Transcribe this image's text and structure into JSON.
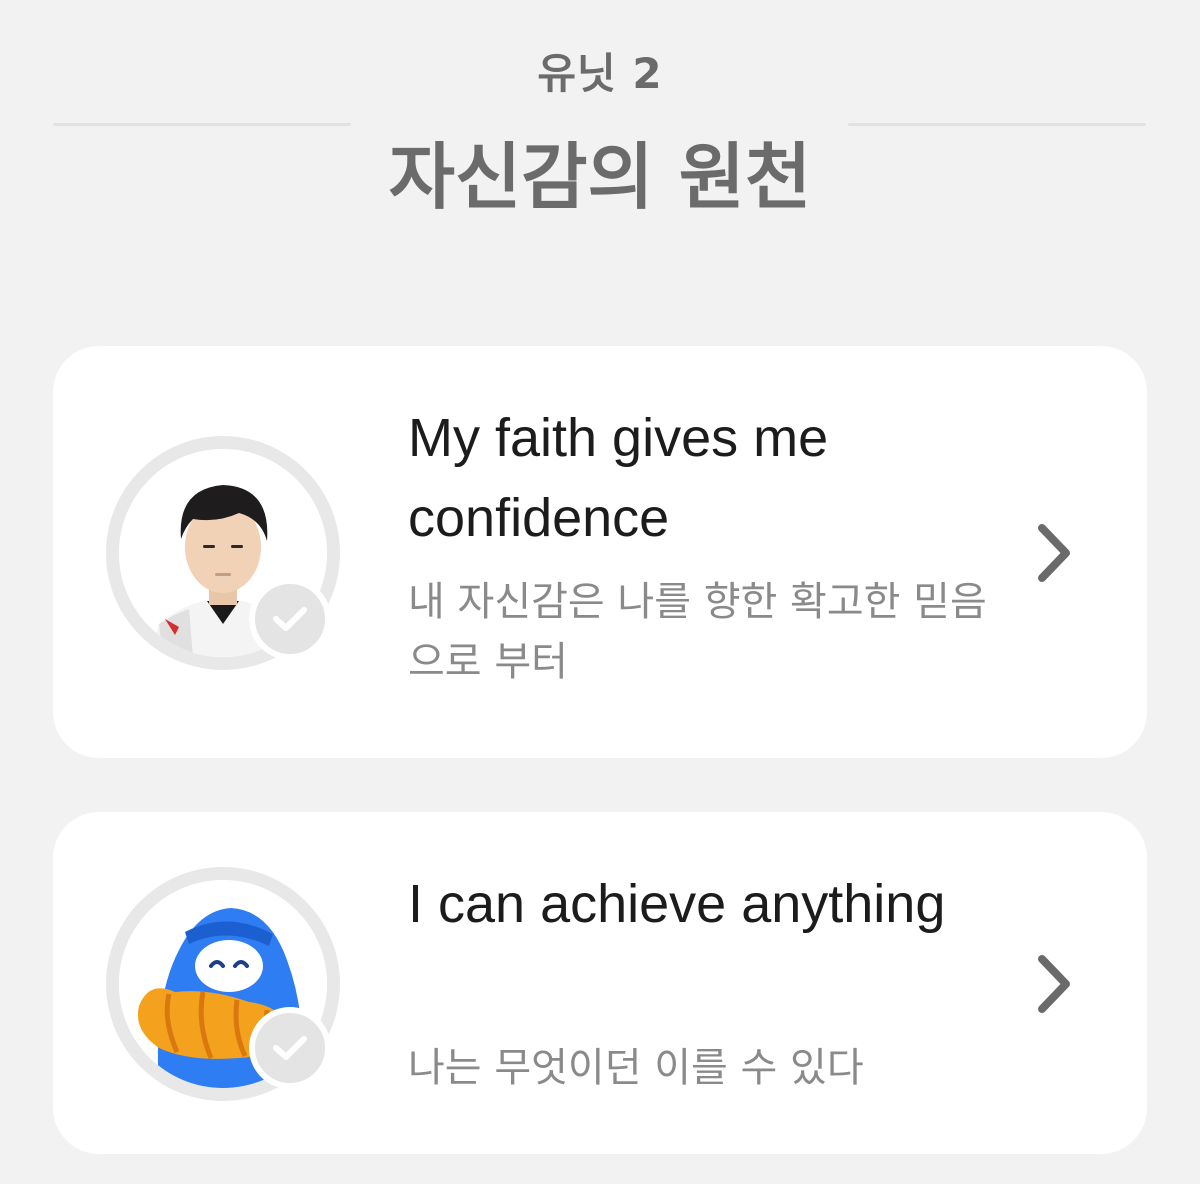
{
  "unit": {
    "label": "유닛 2",
    "title": "자신감의 원천"
  },
  "lessons": [
    {
      "title": "My faith gives me confidence",
      "subtitle": "내 자신감은 나를 향한 확고한 믿음으로 부터",
      "avatar": "player-portrait",
      "completed": true
    },
    {
      "title": "I can achieve anything",
      "subtitle": "나는 무엇이던 이를 수 있다",
      "avatar": "blue-mascot-with-croissant",
      "completed": true
    }
  ],
  "icons": {
    "check": "check-icon",
    "chevron": "chevron-right-icon"
  },
  "colors": {
    "background": "#f2f2f2",
    "card": "#ffffff",
    "title_text": "#1c1c1c",
    "subtitle_text": "#8a8a8a",
    "header_text": "#6b6b6b",
    "badge": "#e4e4e4",
    "mascot_blue": "#2f7df2",
    "croissant": "#f4a21d"
  }
}
